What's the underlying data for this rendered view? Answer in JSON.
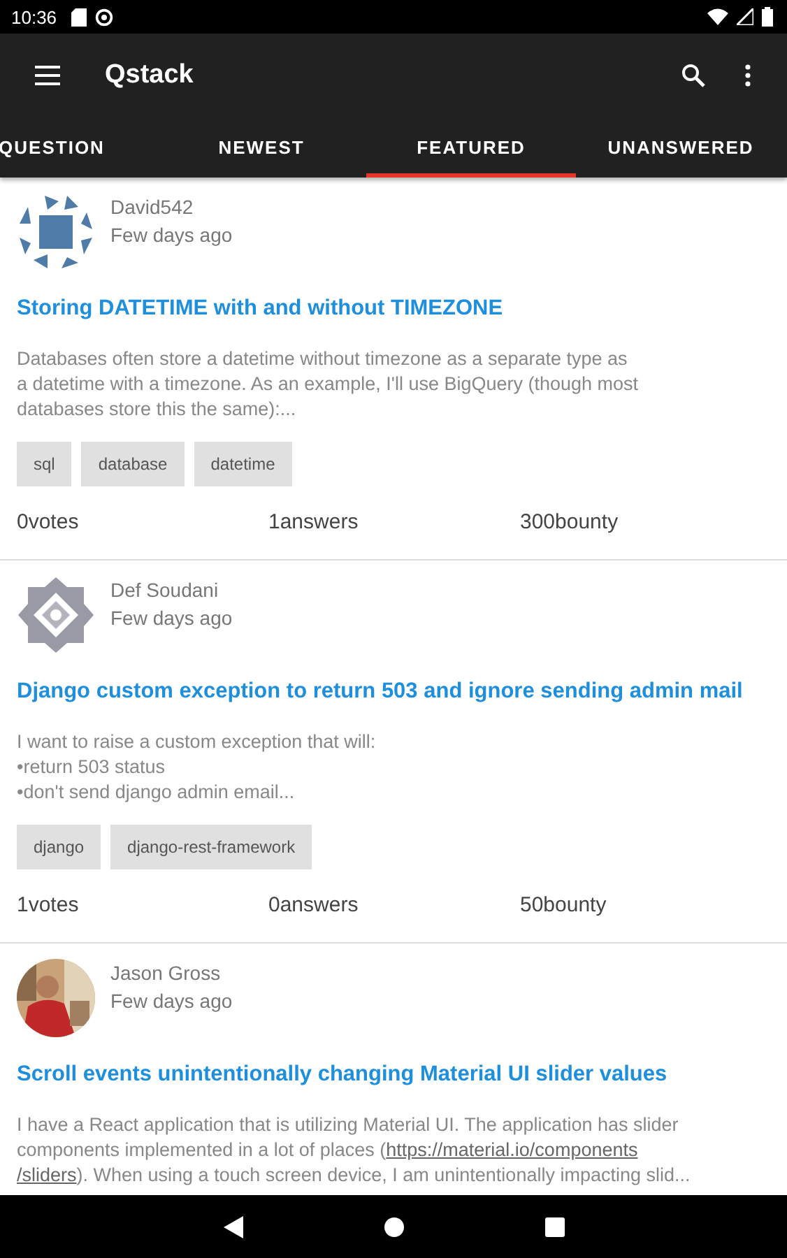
{
  "status_bar": {
    "time": "10:36"
  },
  "app_bar": {
    "title": "Qstack"
  },
  "tabs": [
    {
      "label": "QUESTION",
      "selected": false
    },
    {
      "label": "NEWEST",
      "selected": false
    },
    {
      "label": "FEATURED",
      "selected": true
    },
    {
      "label": "UNANSWERED",
      "selected": false
    }
  ],
  "questions": [
    {
      "avatar": {
        "kind": "squares"
      },
      "author": "David542",
      "time": "Few days ago",
      "title": "Storing DATETIME with and without TIMEZONE",
      "excerpt": [
        [
          {
            "text": "Databases often store a datetime without timezone as a separate type as",
            "link": false
          }
        ],
        [
          {
            "text": "a datetime with a timezone. As an example, I'll use BigQuery (though most",
            "link": false
          }
        ],
        [
          {
            "text": "databases store this the same):...",
            "link": false
          }
        ]
      ],
      "tags": [
        "sql",
        "database",
        "datetime"
      ],
      "votes": "0votes",
      "answers": "1answers",
      "bounty": "300bounty"
    },
    {
      "avatar": {
        "kind": "pattern"
      },
      "author": "Def Soudani",
      "time": "Few days ago",
      "title": "Django custom exception to return 503 and ignore sending admin mail",
      "excerpt": [
        [
          {
            "text": "I want to raise a custom exception that will:",
            "link": false
          }
        ],
        [
          {
            "text": "•return 503 status",
            "link": false
          }
        ],
        [
          {
            "text": "•don't send django admin email...",
            "link": false
          }
        ]
      ],
      "tags": [
        "django",
        "django-rest-framework"
      ],
      "votes": "1votes",
      "answers": "0answers",
      "bounty": "50bounty"
    },
    {
      "avatar": {
        "kind": "picture"
      },
      "author": "Jason Gross",
      "time": "Few days ago",
      "title": "Scroll events unintentionally changing Material UI slider values",
      "excerpt": [
        [
          {
            "text": "I have a React application that is utilizing Material UI. The application has slider",
            "link": false
          }
        ],
        [
          {
            "text": "components implemented in a lot of places (",
            "link": false
          },
          {
            "text": "https://material.io/components",
            "link": true
          }
        ],
        [
          {
            "text": "/sliders",
            "link": true
          },
          {
            "text": "). When using a touch screen device, I am unintentionally impacting slid...",
            "link": false
          }
        ]
      ]
    }
  ]
}
